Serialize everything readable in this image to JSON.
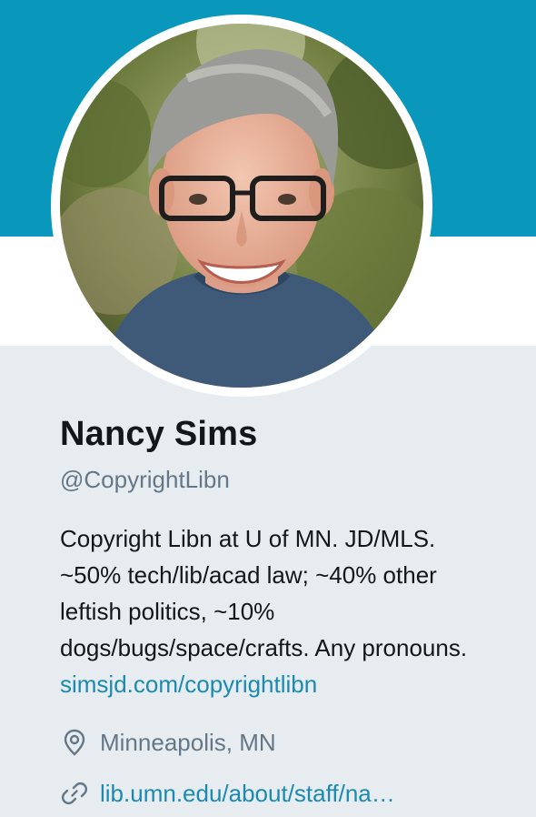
{
  "colors": {
    "banner": "#0a97bc",
    "link": "#1b8ab0",
    "muted": "#657786",
    "text": "#14171a",
    "background": "#e6ecf0"
  },
  "profile": {
    "name": "Nancy Sims",
    "handle": "@CopyrightLibn",
    "avatar_icon": "profile-photo",
    "bio_lines": [
      "Copyright Libn at U of MN. JD/MLS.",
      "~50% tech/lib/acad law; ~40% other",
      "leftish politics, ~10%",
      "dogs/bugs/space/crafts. Any pronouns."
    ],
    "bio_link": "simsjd.com/copyrightlibn",
    "location": "Minneapolis, MN",
    "location_icon": "location-pin-icon",
    "website": "lib.umn.edu/about/staff/na…",
    "website_icon": "link-icon"
  }
}
